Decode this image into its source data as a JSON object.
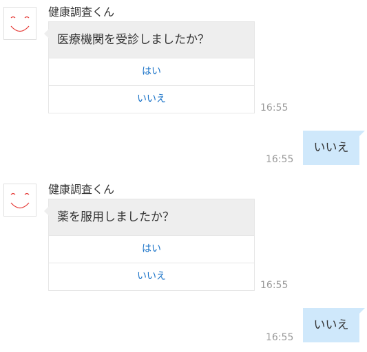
{
  "messages": [
    {
      "bot_name": "健康調査くん",
      "question": "医療機関を受診しましたか？",
      "options": [
        "はい",
        "いいえ"
      ],
      "time": "16:55"
    },
    {
      "user_reply": "いいえ",
      "time": "16:55"
    },
    {
      "bot_name": "健康調査くん",
      "question": "薬を服用しましたか？",
      "options": [
        "はい",
        "いいえ"
      ],
      "time": "16:55"
    },
    {
      "user_reply": "いいえ",
      "time": "16:55"
    }
  ],
  "colors": {
    "link": "#1a73c8",
    "user_bubble": "#cfe8fb",
    "bot_question_bg": "#eeeeee",
    "avatar_face": "#e53935"
  },
  "icons": {
    "avatar": "smiley-face-icon"
  }
}
